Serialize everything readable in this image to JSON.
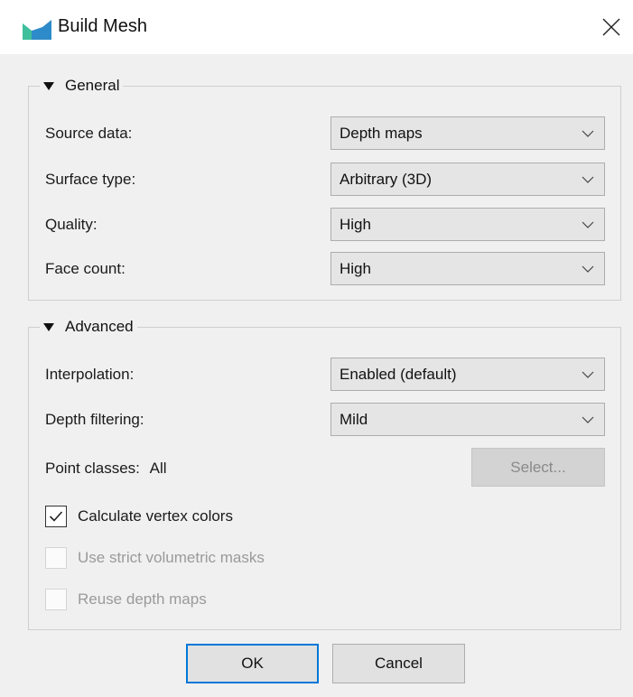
{
  "window": {
    "title": "Build Mesh",
    "app_icon": "mesh-app-icon",
    "close_icon": "close-icon"
  },
  "general": {
    "legend": "General",
    "source_data": {
      "label": "Source data:",
      "value": "Depth maps"
    },
    "surface_type": {
      "label": "Surface type:",
      "value": "Arbitrary (3D)"
    },
    "quality": {
      "label": "Quality:",
      "value": "High"
    },
    "face_count": {
      "label": "Face count:",
      "value": "High"
    }
  },
  "advanced": {
    "legend": "Advanced",
    "interpolation": {
      "label": "Interpolation:",
      "value": "Enabled (default)"
    },
    "depth_filtering": {
      "label": "Depth filtering:",
      "value": "Mild"
    },
    "point_classes": {
      "label": "Point classes:",
      "value": "All",
      "button": "Select..."
    },
    "calc_vertex_colors": {
      "label": "Calculate vertex colors",
      "checked": true,
      "enabled": true
    },
    "strict_volumetric_masks": {
      "label": "Use strict volumetric masks",
      "checked": false,
      "enabled": false
    },
    "reuse_depth_maps": {
      "label": "Reuse depth maps",
      "checked": false,
      "enabled": false
    }
  },
  "buttons": {
    "ok": "OK",
    "cancel": "Cancel"
  },
  "colors": {
    "accent": "#0078d7",
    "background": "#f0f0f0",
    "titlebar": "#ffffff"
  }
}
